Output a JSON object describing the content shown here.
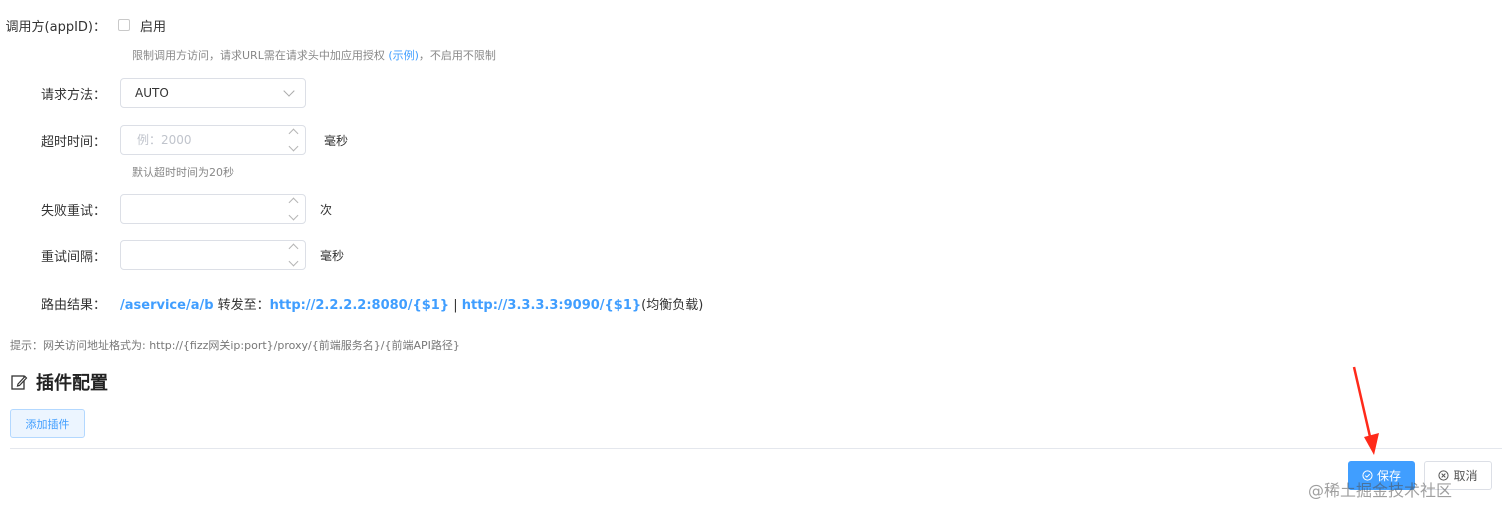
{
  "form": {
    "appid": {
      "label": "调用方(appID)：",
      "checkbox_label": "启用",
      "checked": false,
      "hint_prefix": "限制调用方访问，请求URL需在请求头中加应用授权 ",
      "hint_link": "(示例)",
      "hint_suffix": "，不启用不限制"
    },
    "method": {
      "label": "请求方法：",
      "value": "AUTO"
    },
    "timeout": {
      "label": "超时时间：",
      "placeholder": "例：2000",
      "unit": "毫秒",
      "hint": "默认超时时间为20秒"
    },
    "retry": {
      "label": "失败重试：",
      "placeholder": "",
      "unit": "次"
    },
    "retry_interval": {
      "label": "重试间隔：",
      "placeholder": "",
      "unit": "毫秒"
    },
    "route": {
      "label": "路由结果：",
      "path": "/aservice/a/b",
      "forward_text": " 转发至：",
      "target1": "http://2.2.2.2:8080/{$1}",
      "separator": " | ",
      "target2": "http://3.3.3.3:9090/{$1}",
      "suffix": "(均衡负载)"
    }
  },
  "tip": "提示：网关访问地址格式为: http://{fizz网关ip:port}/proxy/{前端服务名}/{前端API路径}",
  "plugins": {
    "title": "插件配置",
    "add_button": "添加插件"
  },
  "footer": {
    "save_label": "保存",
    "cancel_label": "取消"
  },
  "watermark": "@稀土掘金技术社区",
  "colors": {
    "accent": "#409eff",
    "annotation_arrow": "#ff2a1a"
  }
}
